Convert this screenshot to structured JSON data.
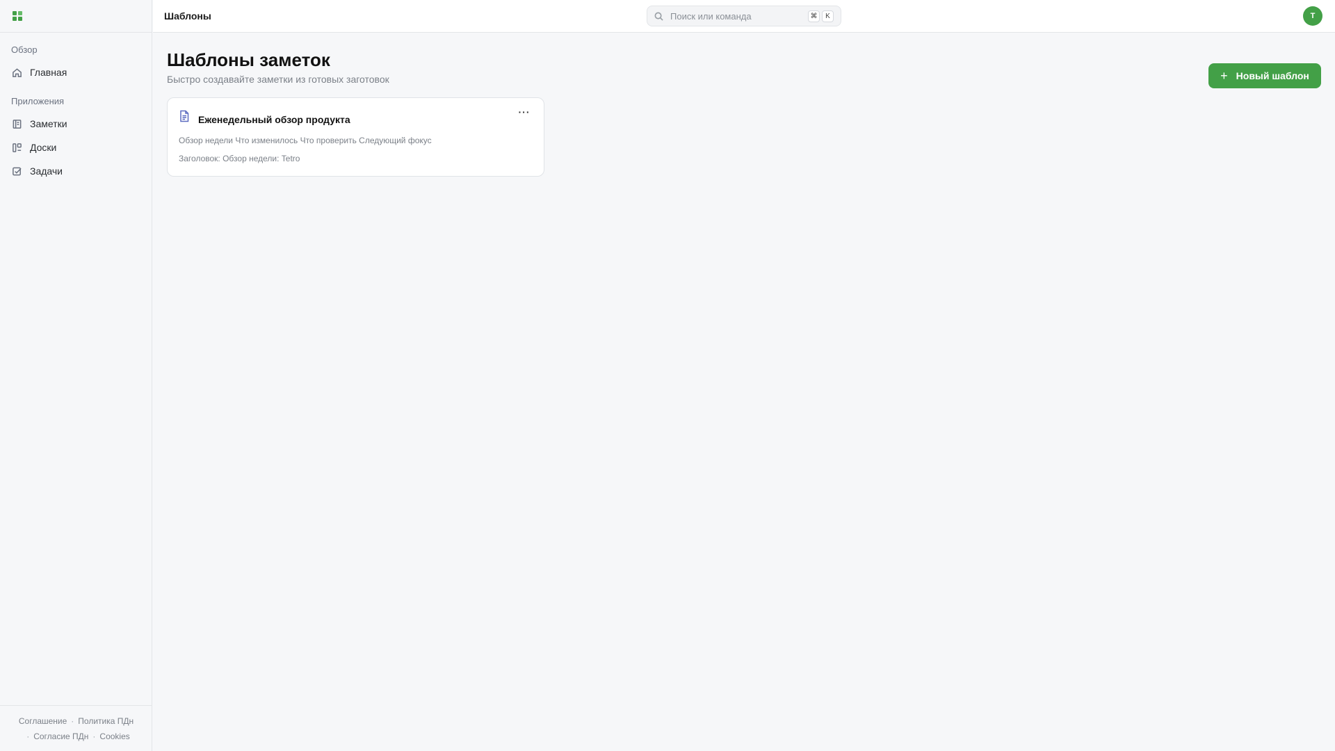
{
  "sidebar": {
    "sections": [
      {
        "heading": "Обзор",
        "items": [
          {
            "label": "Главная",
            "icon": "home-icon"
          }
        ]
      },
      {
        "heading": "Приложения",
        "items": [
          {
            "label": "Заметки",
            "icon": "notes-icon"
          },
          {
            "label": "Доски",
            "icon": "boards-icon"
          },
          {
            "label": "Задачи",
            "icon": "tasks-icon"
          }
        ]
      }
    ],
    "footer": {
      "agreement": "Соглашение",
      "privacy_policy": "Политика ПДн",
      "consent": "Согласие ПДн",
      "cookies": "Cookies"
    }
  },
  "header": {
    "title": "Шаблоны",
    "search": {
      "placeholder": "Поиск или команда",
      "value": "",
      "shortcut_keys": [
        "⌘",
        "K"
      ]
    },
    "avatar_initial": "T"
  },
  "main": {
    "title": "Шаблоны заметок",
    "subtitle": "Быстро создавайте заметки из готовых заготовок",
    "new_button_label": "Новый шаблон",
    "templates": [
      {
        "title": "Еженедельный обзор продукта",
        "preview": "Обзор недели Что изменилось Что проверить Следующий фокус",
        "meta": "Заголовок: Обзор недели: Tetro",
        "menu_glyph": "···"
      }
    ]
  },
  "colors": {
    "accent": "#43a047",
    "doc_icon": "#5c6bc0"
  }
}
